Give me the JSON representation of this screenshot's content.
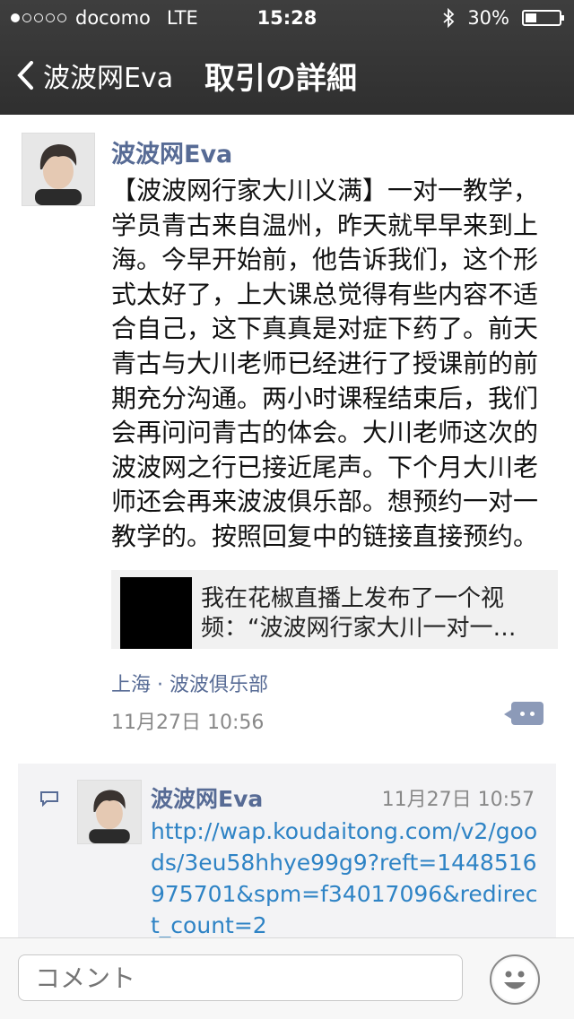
{
  "status_bar": {
    "carrier": "docomo",
    "network": "LTE",
    "time": "15:28",
    "battery": "30%",
    "battery_level": 0.3,
    "signal_bars_filled": 1,
    "signal_bars_total": 5
  },
  "nav": {
    "back_label": "波波网Eva",
    "title": "取引の詳細"
  },
  "post": {
    "author": "波波网Eva",
    "text": "【波波网行家大川义满】一对一教学，学员青古来自温州，昨天就早早来到上海。今早开始前，他告诉我们，这个形式太好了，上大课总觉得有些内容不适合自己，这下真真是对症下药了。前天青古与大川老师已经进行了授课前的前期充分沟通。两小时课程结束后，我们会再问问青古的体会。大川老师这次的波波网之行已接近尾声。下个月大川老师还会再来波波俱乐部。想预约一对一教学的。按照回复中的链接直接预约。",
    "share_text": "我在花椒直播上发布了一个视频：“波波网行家大川一对一…",
    "location": "上海 · 波波俱乐部",
    "timestamp": "11月27日 10:56"
  },
  "comment": {
    "author": "波波网Eva",
    "time": "11月27日 10:57",
    "text": "http://wap.koudaitong.com/v2/goods/3eu58hhye99g9?reft=1448516975701&spm=f34017096&redirect_count=2"
  },
  "input": {
    "placeholder": "コメント"
  },
  "icons": [
    "back-chevron-icon",
    "bluetooth-icon",
    "battery-icon",
    "comment-icon",
    "more-icon",
    "emoji-icon"
  ],
  "colors": {
    "header_bg": "#333333",
    "name_blue": "#576b95",
    "link_blue": "#2e83c5",
    "comment_bg": "#f3f3f5"
  }
}
